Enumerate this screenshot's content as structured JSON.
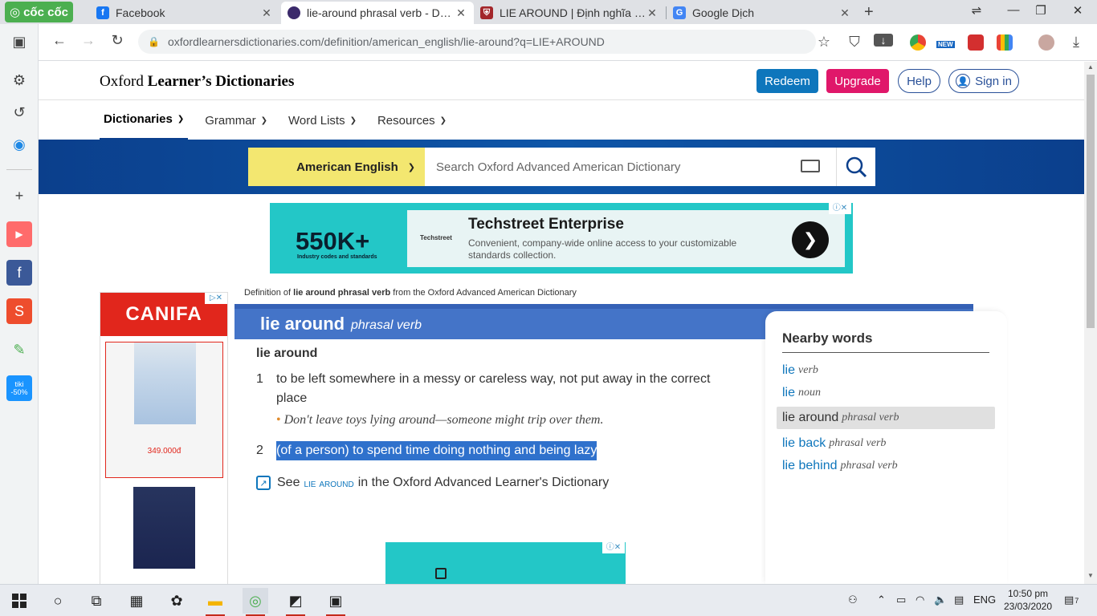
{
  "browser": {
    "brand": "cốc cốc",
    "tabs": [
      {
        "title": "Facebook",
        "icon": "facebook-icon"
      },
      {
        "title": "lie-around phrasal verb - Definition",
        "icon": "oxford-icon"
      },
      {
        "title": "LIE AROUND | Định nghĩa trong",
        "icon": "cambridge-icon"
      },
      {
        "title": "Google Dịch",
        "icon": "google-translate-icon"
      }
    ],
    "url": "oxfordlearnersdictionaries.com/definition/american_english/lie-around?q=LIE+AROUND",
    "new_badge": "NEW"
  },
  "site": {
    "logo_light": "Oxford ",
    "logo_bold": "Learner’s Dictionaries",
    "redeem": "Redeem",
    "upgrade": "Upgrade",
    "help": "Help",
    "sign_in": "Sign in",
    "nav": [
      {
        "label": "Dictionaries"
      },
      {
        "label": "Grammar"
      },
      {
        "label": "Word Lists"
      },
      {
        "label": "Resources"
      }
    ],
    "dictionary_select": "American English",
    "search_placeholder": "Search Oxford Advanced American Dictionary"
  },
  "top_ad": {
    "big_number": "550K+",
    "caption": "Industry codes and standards",
    "brand": "Techstreet",
    "title": "Techstreet Enterprise",
    "description": "Convenient, company-wide online access to your customizable standards collection."
  },
  "left_ad": {
    "brand": "CANIFA",
    "price": "349.000đ"
  },
  "entry": {
    "source_prefix": "Definition of ",
    "source_bold": "lie around phrasal verb",
    "source_suffix": " from the Oxford Advanced American Dictionary",
    "headword": "lie around",
    "pos": "phrasal verb",
    "phrasal_head": "lie around",
    "senses": [
      {
        "num": "1",
        "def": "to be left somewhere in a messy or careless way, not put away in the correct place"
      },
      {
        "num": "2",
        "def": "(of a person) to spend time doing nothing and being lazy"
      }
    ],
    "example": "Don't leave toys lying around—someone might trip over them.",
    "see_prefix": "See",
    "see_term": "lie around",
    "see_suffix": "in the Oxford Advanced Learner's Dictionary"
  },
  "nearby": {
    "title": "Nearby words",
    "items": [
      {
        "word": "lie",
        "pos": "verb"
      },
      {
        "word": "lie",
        "pos": "noun"
      },
      {
        "word": "lie around",
        "pos": "phrasal verb"
      },
      {
        "word": "lie back",
        "pos": "phrasal verb"
      },
      {
        "word": "lie behind",
        "pos": "phrasal verb"
      }
    ]
  },
  "taskbar": {
    "language": "ENG",
    "time": "10:50 pm",
    "date": "23/03/2020",
    "notifications": "7"
  },
  "colors": {
    "oxford_blue": "#0b3f8c",
    "headword_bar": "#4474c8",
    "redeem": "#0e76bc",
    "upgrade": "#e0176a",
    "selector_yellow": "#f3e770",
    "ad_teal": "#23c7c7",
    "canifa_red": "#e1261c"
  }
}
